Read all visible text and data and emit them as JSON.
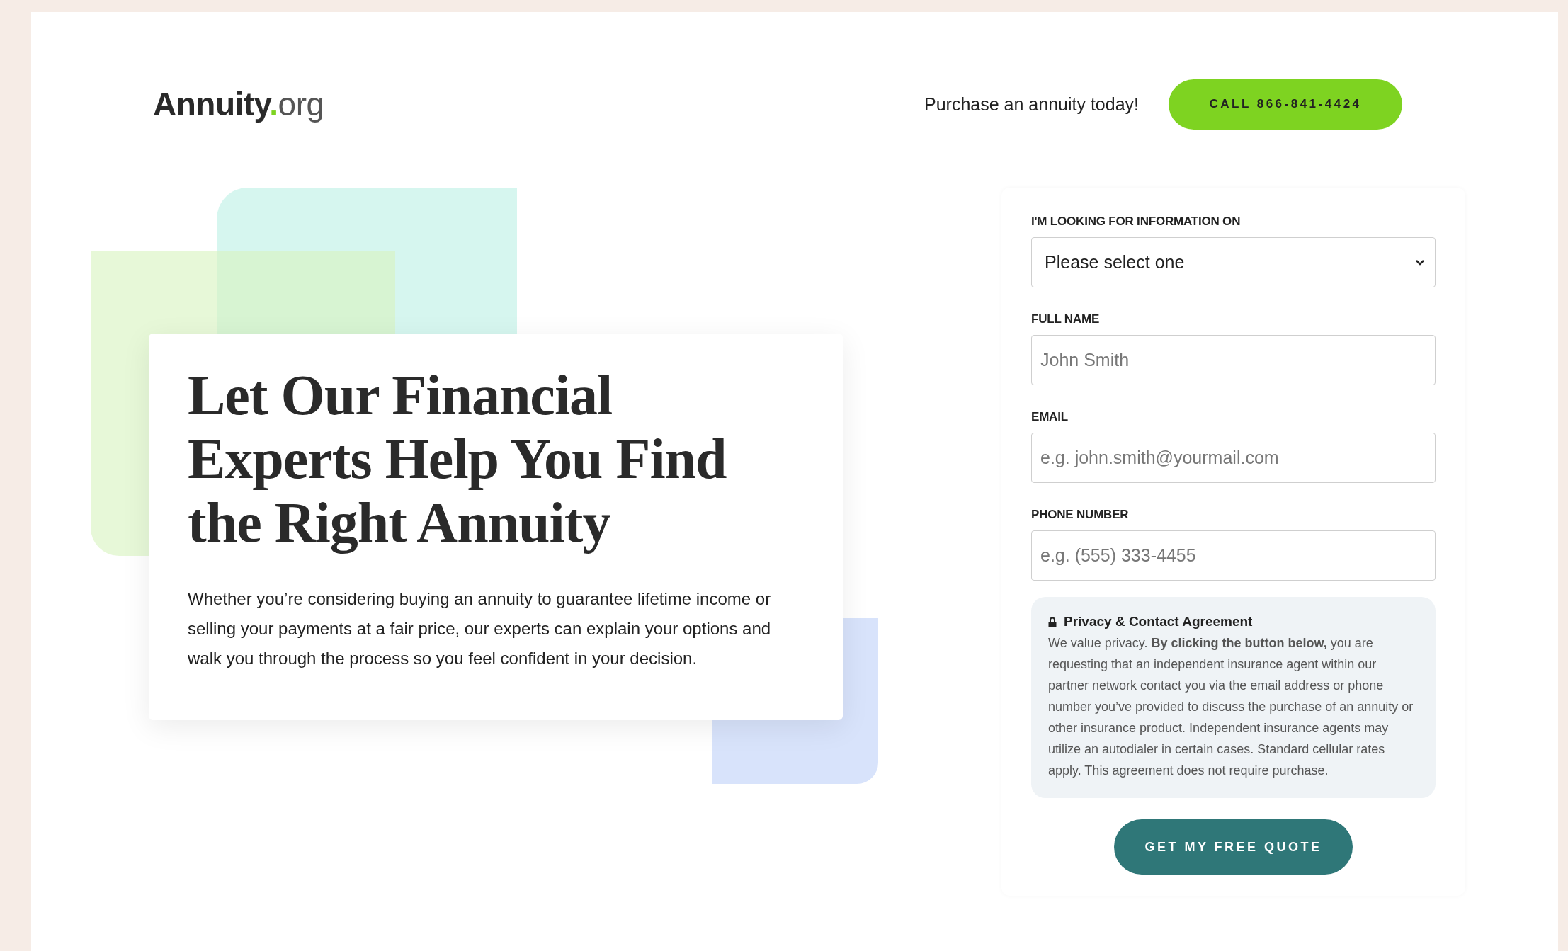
{
  "header": {
    "logo": {
      "name": "Annuity",
      "dot": ".",
      "suffix": "org"
    },
    "tagline": "Purchase an annuity today!",
    "call_button": "CALL 866-841-4424"
  },
  "hero": {
    "heading": [
      "Let Our Financial",
      "Experts Help You Find",
      "the Right Annuity"
    ],
    "text": "Whether you’re considering buying an annuity to guarantee lifetime income or selling your payments at a fair price, our experts can explain your options and walk you through the process so you feel confident in your decision."
  },
  "form": {
    "fields": [
      {
        "kind": "select",
        "label": "I'M LOOKING FOR INFORMATION ON",
        "value": "Please select one"
      },
      {
        "kind": "input",
        "label": "FULL NAME",
        "placeholder": "John Smith"
      },
      {
        "kind": "input",
        "label": "EMAIL",
        "placeholder": "e.g. john.smith@yourmail.com"
      },
      {
        "kind": "input",
        "label": "PHONE NUMBER",
        "placeholder": "e.g. (555) 333-4455"
      }
    ],
    "privacy": {
      "title": "Privacy & Contact Agreement",
      "text": "We value privacy. **By clicking the button below,** you are requesting that an independent insurance agent within our partner network contact you via the email address or phone number you’ve provided to discuss the purchase of an annuity or other insurance product. Independent insurance agents may utilize an autodialer in certain cases. Standard cellular rates apply. This agreement does not require purchase."
    },
    "submit": "GET MY FREE QUOTE"
  }
}
